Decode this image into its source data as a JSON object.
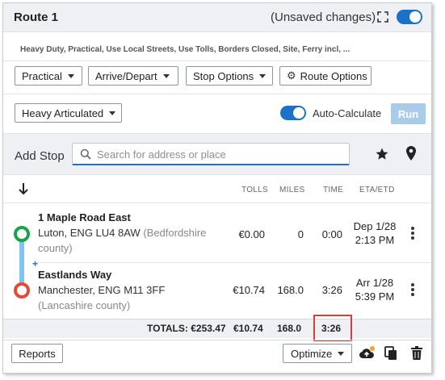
{
  "header": {
    "title": "Route 1",
    "unsaved": "(Unsaved changes)",
    "expand_icon": "expand-icon",
    "toggle_on": true
  },
  "subtitle": "Heavy Duty, Practical, Use Local Streets, Use Tolls, Borders Closed, Site, Ferry incl, ...",
  "toolbar": {
    "practical": "Practical",
    "arrive_depart": "Arrive/Depart",
    "stop_options": "Stop Options",
    "route_options": "Route Options",
    "vehicle": "Heavy Articulated",
    "auto_calculate": "Auto-Calculate",
    "auto_calculate_on": true,
    "run": "Run"
  },
  "add_stop": {
    "label": "Add Stop",
    "placeholder": "Search for address or place"
  },
  "columns": {
    "tolls": "TOLLS",
    "miles": "MILES",
    "time": "TIME",
    "eta": "ETA/ETD"
  },
  "stops": [
    {
      "name": "1 Maple Road East",
      "address": "Luton, ENG LU4 8AW",
      "region": "(Bedfordshire county)",
      "tolls": "€0.00",
      "miles": "0",
      "time": "0:00",
      "eta_line1": "Dep 1/28",
      "eta_line2": "2:13 PM"
    },
    {
      "name": "Eastlands Way",
      "address": "Manchester, ENG M11 3FF",
      "region": "(Lancashire county)",
      "tolls": "€10.74",
      "miles": "168.0",
      "time": "3:26",
      "eta_line1": "Arr 1/28",
      "eta_line2": "5:39 PM"
    }
  ],
  "totals": {
    "label": "TOTALS: €253.47",
    "tolls": "€10.74",
    "miles": "168.0",
    "time": "3:26"
  },
  "footer": {
    "reports": "Reports",
    "optimize": "Optimize"
  },
  "colors": {
    "accent": "#1a73c8",
    "start_marker": "#1aa34a",
    "end_marker": "#e24b3b",
    "route_line": "#7ec4ec",
    "highlight": "#e03a3a"
  }
}
